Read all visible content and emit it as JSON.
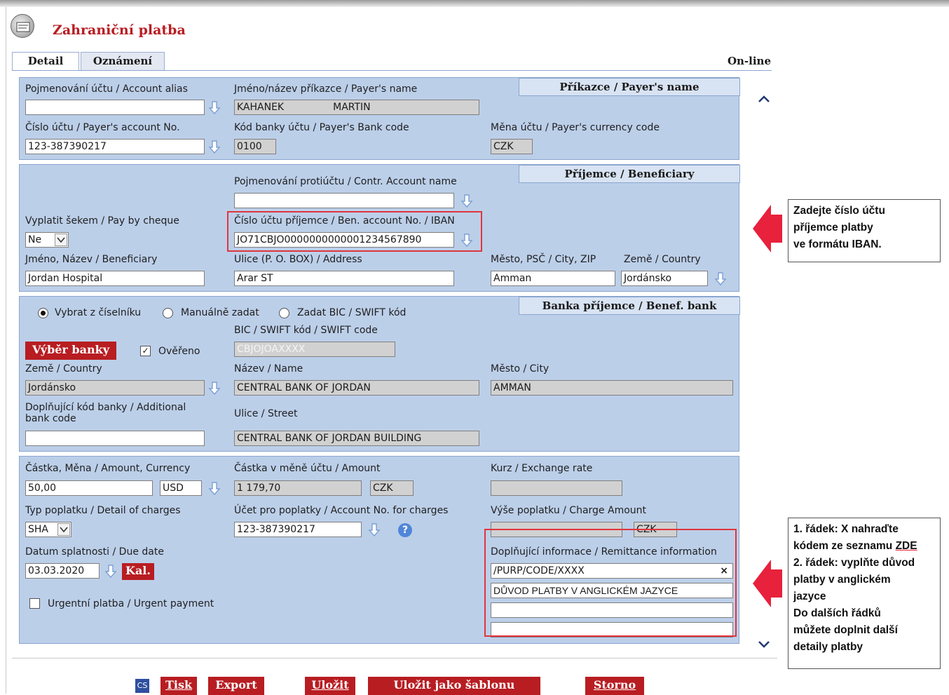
{
  "window": {
    "title": "Zahraniční platba",
    "mode": "On-line"
  },
  "tabs": [
    {
      "label": "Detail",
      "active": true
    },
    {
      "label": "Oznámení",
      "active": false
    }
  ],
  "payer": {
    "heading": "Příkazce / Payer's name",
    "alias_label": "Pojmenování účtu / Account alias",
    "alias_value": "",
    "name_label": "Jméno/název příkazce / Payer's name",
    "name_first": "KAHANEK",
    "name_last": "MARTIN",
    "account_label": "Číslo účtu / Payer's account No.",
    "account_value": "123-387390217",
    "bank_code_label": "Kód banky účtu / Payer's Bank code",
    "bank_code_value": "0100",
    "currency_label": "Měna účtu / Payer's currency code",
    "currency_value": "CZK"
  },
  "beneficiary": {
    "heading": "Příjemce / Beneficiary",
    "contr_name_label": "Pojmenování protiúčtu / Contr. Account name",
    "contr_name_value": "",
    "cheque_label": "Vyplatit šekem / Pay by cheque",
    "cheque_value": "Ne",
    "iban_label": "Číslo účtu příjemce / Ben. account No. / IBAN",
    "iban_value": "JO71CBJO0000000000001234567890",
    "name_label": "Jméno, Název / Beneficiary",
    "name_value": "Jordan Hospital",
    "address_label": "Ulice (P. O. BOX) / Address",
    "address_value": "Arar ST",
    "city_label": "Město, PSČ / City, ZIP",
    "city_value": "Amman",
    "country_label": "Země / Country",
    "country_value": "Jordánsko"
  },
  "bank": {
    "heading": "Banka příjemce / Benef. bank",
    "radio_options": [
      {
        "label": "Vybrat z číselníku",
        "checked": true
      },
      {
        "label": "Manuálně zadat",
        "checked": false
      },
      {
        "label": "Zadat BIC / SWIFT kód",
        "checked": false
      }
    ],
    "bic_label": "BIC / SWIFT kód / SWIFT code",
    "bic_value": "CBJOJOAXXXX",
    "select_bank_button": "Výběr banky",
    "verified_label": "Ověřeno",
    "verified_checked": true,
    "country_label": "Země / Country",
    "country_value": "Jordánsko",
    "name_label": "Název / Name",
    "name_value": "CENTRAL BANK OF JORDAN",
    "city_label": "Město / City",
    "city_value": "AMMAN",
    "additional_code_label_1": "Doplňující kód banky / Additional",
    "additional_code_label_2": "bank code",
    "additional_code_value": "",
    "street_label": "Ulice / Street",
    "street_value": "CENTRAL BANK OF JORDAN BUILDING"
  },
  "amount": {
    "amount_label": "Částka, Měna / Amount, Currency",
    "amount_value": "50,00",
    "currency_value": "USD",
    "acc_amount_label": "Částka v měně účtu / Amount",
    "acc_amount_value": "1 179,70",
    "acc_currency_value": "CZK",
    "rate_label": "Kurz / Exchange rate",
    "rate_value": "",
    "charges_label": "Typ poplatku / Detail of charges",
    "charges_value": "SHA",
    "charges_account_label": "Účet pro poplatky / Account No. for charges",
    "charges_account_value": "123-387390217",
    "charge_amount_label": "Výše poplatku / Charge Amount",
    "charge_amount_value": "",
    "charge_currency_value": "CZK",
    "due_label": "Datum splatnosti / Due date",
    "due_value": "03.03.2020",
    "calendar_button": "Kal.",
    "urgent_label": "Urgentní platba / Urgent payment",
    "urgent_checked": false,
    "remittance_label": "Doplňující informace / Remittance information",
    "remittance_lines": [
      "/PURP/CODE/XXXX",
      "DŮVOD PLATBY V ANGLICKÉM JAZYCE",
      "",
      ""
    ]
  },
  "footer": {
    "lang": "CS",
    "buttons": [
      "Tisk",
      "Export",
      "Uložit",
      "Uložit jako šablonu",
      "Storno"
    ]
  },
  "annotations": {
    "iban_note": [
      "Zadejte číslo účtu",
      "příjemce platby",
      "ve formátu IBAN."
    ],
    "remittance_note": {
      "line1a": "1. řádek: X nahraďte",
      "line1b": "kódem ze seznamu ",
      "link": "ZDE",
      "line2": [
        "2. řádek: vyplňte důvod",
        "platby v anglickém",
        "jazyce"
      ],
      "line3": [
        "Do dalších řádků",
        "můžete doplnit další",
        "detaily platby"
      ]
    },
    "pointer_color": "#e8213c"
  },
  "colors": {
    "accent": "#b81d22",
    "panel": "#bccfe9",
    "highlight": "#e0353d"
  }
}
